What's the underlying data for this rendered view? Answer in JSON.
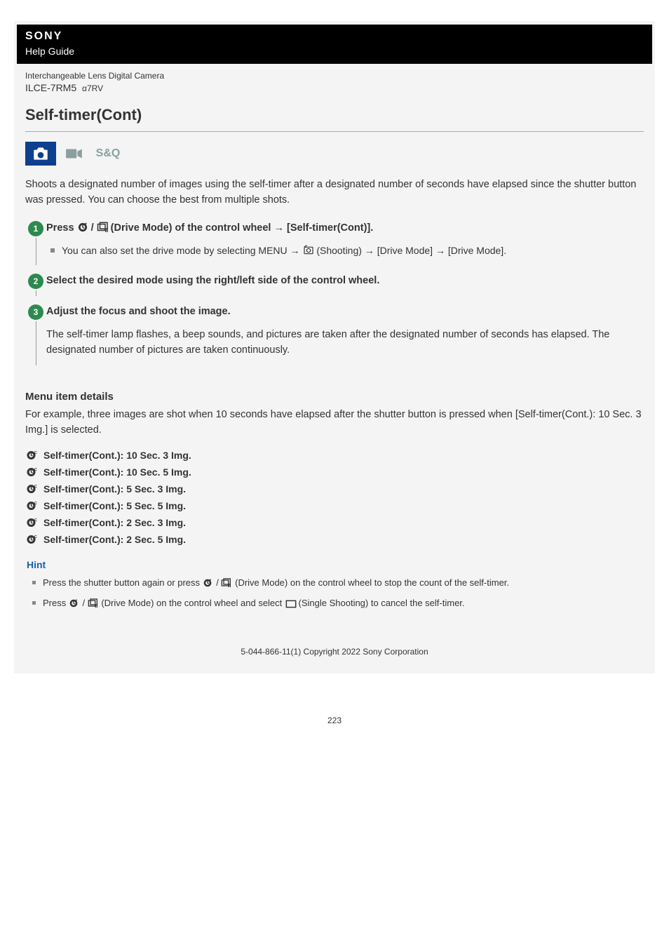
{
  "header": {
    "brand": "SONY",
    "help_guide": "Help Guide",
    "product_type": "Interchangeable Lens Digital Camera",
    "model": "ILCE-7RM5",
    "model_suffix": "α7RV"
  },
  "page_title": "Self-timer(Cont)",
  "mode_badges": {
    "active": "photo",
    "inactive1": "video",
    "inactive2": "S&Q"
  },
  "intro": "Shoots a designated number of images using the self-timer after a designated number of seconds have elapsed since the shutter button was pressed. You can choose the best from multiple shots.",
  "steps": [
    {
      "num": "1",
      "title_pre": "Press ",
      "title_mid": " (Drive Mode) of the control wheel → [Self-timer(Cont)].",
      "bullet_pre": "You can also set the drive mode by selecting MENU → ",
      "bullet_post": " (Shooting) → [Drive Mode] → [Drive Mode]."
    },
    {
      "num": "2",
      "title": "Select the desired mode using the right/left side of the control wheel."
    },
    {
      "num": "3",
      "title": "Adjust the focus and shoot the image.",
      "desc": "The self-timer lamp flashes, a beep sounds, and pictures are taken after the designated number of seconds has elapsed. The designated number of pictures are taken continuously."
    }
  ],
  "details": {
    "heading": "Menu item details",
    "text": "For example, three images are shot when 10 seconds have elapsed after the shutter button is pressed when [Self-timer(Cont.): 10 Sec. 3 Img.] is selected.",
    "items": [
      "Self-timer(Cont.): 10 Sec. 3 Img.",
      "Self-timer(Cont.): 10 Sec. 5 Img.",
      "Self-timer(Cont.): 5 Sec. 3 Img.",
      "Self-timer(Cont.): 5 Sec. 5 Img.",
      "Self-timer(Cont.): 2 Sec. 3 Img.",
      "Self-timer(Cont.): 2 Sec. 5 Img."
    ]
  },
  "hint": {
    "title": "Hint",
    "b1_pre": "Press the shutter button again or press ",
    "b1_post": " (Drive Mode) on the control wheel to stop the count of the self-timer.",
    "b2_pre": "Press ",
    "b2_mid": " (Drive Mode) on the control wheel and select ",
    "b2_post": " (Single Shooting) to cancel the self-timer."
  },
  "footer": "5-044-866-11(1) Copyright 2022 Sony Corporation",
  "page_number": "223"
}
